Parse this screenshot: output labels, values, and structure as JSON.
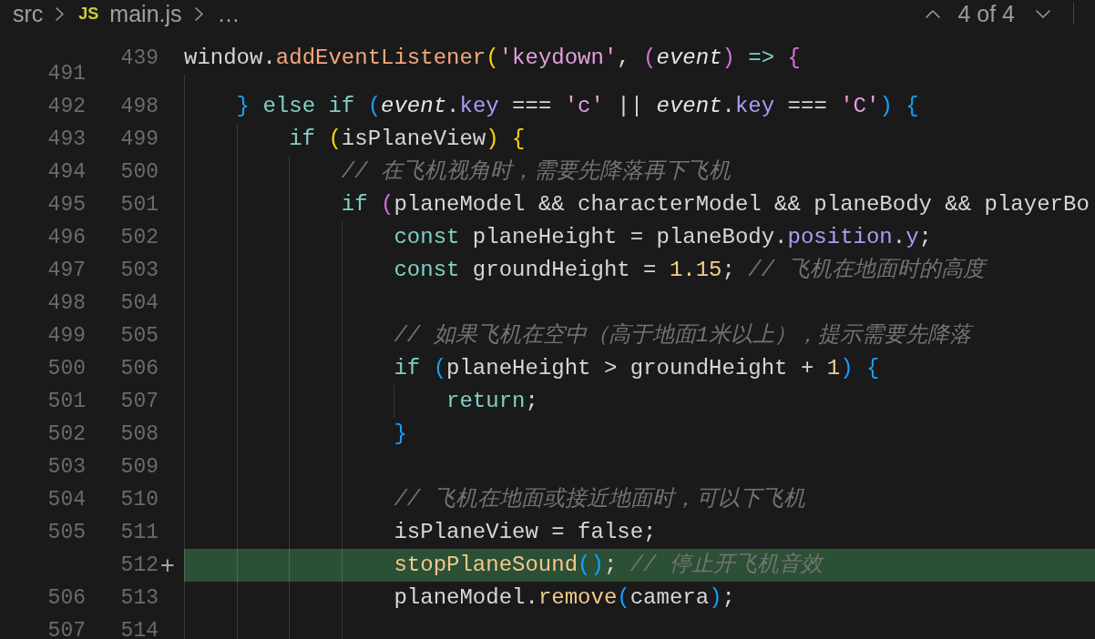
{
  "breadcrumb": [
    {
      "kind": "folder",
      "label": "src"
    },
    {
      "kind": "file",
      "file_type": "JS",
      "label": "main.js"
    },
    {
      "kind": "more",
      "label": "…"
    }
  ],
  "change_navigation": {
    "counter": "4 of 4"
  },
  "editor": {
    "sticky_line": {
      "new": "439",
      "code": [
        {
          "kind": "plain",
          "text": "window."
        },
        {
          "kind": "builtin",
          "text": "addEventListener"
        },
        {
          "kind": "bracket1",
          "text": "("
        },
        {
          "kind": "string",
          "text": "'keydown'"
        },
        {
          "kind": "plain",
          "text": ", "
        },
        {
          "kind": "bracket2",
          "text": "("
        },
        {
          "kind": "param",
          "text": "event"
        },
        {
          "kind": "bracket2",
          "text": ") "
        },
        {
          "kind": "keyword",
          "text": "=> "
        },
        {
          "kind": "bracket2",
          "text": "{"
        }
      ]
    },
    "lines": [
      {
        "old": "491",
        "added": false
      },
      {
        "old": "492",
        "new": "498",
        "added": false,
        "code": [
          {
            "kind": "bracket3",
            "text": "    }"
          },
          {
            "kind": "keyword",
            "text": " else"
          },
          {
            "kind": "keyword",
            "text": " if"
          },
          {
            "kind": "bracket3",
            "text": " ("
          },
          {
            "kind": "param",
            "text": "event"
          },
          {
            "kind": "plain",
            "text": "."
          },
          {
            "kind": "prop",
            "text": "key"
          },
          {
            "kind": "plain",
            "text": " === "
          },
          {
            "kind": "string",
            "text": "'c'"
          },
          {
            "kind": "plain",
            "text": " || "
          },
          {
            "kind": "param",
            "text": "event"
          },
          {
            "kind": "plain",
            "text": "."
          },
          {
            "kind": "prop",
            "text": "key"
          },
          {
            "kind": "plain",
            "text": " === "
          },
          {
            "kind": "string",
            "text": "'C'"
          },
          {
            "kind": "bracket3",
            "text": ")"
          },
          {
            "kind": "bracket3",
            "text": " {"
          }
        ]
      },
      {
        "old": "493",
        "new": "499",
        "added": false,
        "code": [
          {
            "kind": "keyword",
            "text": "        if"
          },
          {
            "kind": "bracket1",
            "text": " ("
          },
          {
            "kind": "plain",
            "text": "isPlaneView"
          },
          {
            "kind": "bracket1",
            "text": ")"
          },
          {
            "kind": "bracket1",
            "text": " {"
          }
        ]
      },
      {
        "old": "494",
        "new": "500",
        "added": false,
        "code": [
          {
            "kind": "comment",
            "text": "            // 在飞机视角时，需要先降落再下飞机"
          }
        ]
      },
      {
        "old": "495",
        "new": "501",
        "added": false,
        "code": [
          {
            "kind": "keyword",
            "text": "            if"
          },
          {
            "kind": "bracket2",
            "text": " ("
          },
          {
            "kind": "plain",
            "text": "planeModel && characterModel && planeBody && playerBo"
          }
        ]
      },
      {
        "old": "496",
        "new": "502",
        "added": false,
        "code": [
          {
            "kind": "keyword",
            "text": "                const"
          },
          {
            "kind": "plain",
            "text": " planeHeight = planeBody."
          },
          {
            "kind": "prop",
            "text": "position"
          },
          {
            "kind": "plain",
            "text": "."
          },
          {
            "kind": "prop",
            "text": "y"
          },
          {
            "kind": "plain",
            "text": ";"
          }
        ]
      },
      {
        "old": "497",
        "new": "503",
        "added": false,
        "code": [
          {
            "kind": "keyword",
            "text": "                const"
          },
          {
            "kind": "plain",
            "text": " groundHeight = "
          },
          {
            "kind": "number",
            "text": "1.15"
          },
          {
            "kind": "plain",
            "text": "; "
          },
          {
            "kind": "comment",
            "text": "// 飞机在地面时的高度"
          }
        ]
      },
      {
        "old": "498",
        "new": "504",
        "added": false
      },
      {
        "old": "499",
        "new": "505",
        "added": false,
        "code": [
          {
            "kind": "comment",
            "text": "                // 如果飞机在空中（高于地面1米以上），提示需要先降落"
          }
        ]
      },
      {
        "old": "500",
        "new": "506",
        "added": false,
        "code": [
          {
            "kind": "keyword",
            "text": "                if"
          },
          {
            "kind": "bracket3",
            "text": " ("
          },
          {
            "kind": "plain",
            "text": "planeHeight > groundHeight + "
          },
          {
            "kind": "number",
            "text": "1"
          },
          {
            "kind": "bracket3",
            "text": ")"
          },
          {
            "kind": "bracket3",
            "text": " {"
          }
        ]
      },
      {
        "old": "501",
        "new": "507",
        "added": false,
        "code": [
          {
            "kind": "keyword",
            "text": "                    return"
          },
          {
            "kind": "plain",
            "text": ";"
          }
        ]
      },
      {
        "old": "502",
        "new": "508",
        "added": false,
        "code": [
          {
            "kind": "bracket3",
            "text": "                }"
          }
        ]
      },
      {
        "old": "503",
        "new": "509",
        "added": false
      },
      {
        "old": "504",
        "new": "510",
        "added": false,
        "code": [
          {
            "kind": "comment",
            "text": "                // 飞机在地面或接近地面时，可以下飞机"
          }
        ]
      },
      {
        "old": "505",
        "new": "511",
        "added": false,
        "code": [
          {
            "kind": "plain",
            "text": "                isPlaneView = false;"
          }
        ]
      },
      {
        "new": "512",
        "sign": "+",
        "added": true,
        "code": [
          {
            "kind": "func",
            "text": "                stopPlaneSound"
          },
          {
            "kind": "bracket3",
            "text": "()"
          },
          {
            "kind": "plain",
            "text": "; "
          },
          {
            "kind": "comment",
            "text": "// 停止开飞机音效"
          }
        ]
      },
      {
        "old": "506",
        "new": "513",
        "added": false,
        "code": [
          {
            "kind": "plain",
            "text": "                planeModel."
          },
          {
            "kind": "func",
            "text": "remove"
          },
          {
            "kind": "bracket3",
            "text": "("
          },
          {
            "kind": "plain",
            "text": "camera"
          },
          {
            "kind": "bracket3",
            "text": ")"
          },
          {
            "kind": "plain",
            "text": ";"
          }
        ]
      },
      {
        "old": "507",
        "new": "514",
        "added": false
      }
    ]
  }
}
